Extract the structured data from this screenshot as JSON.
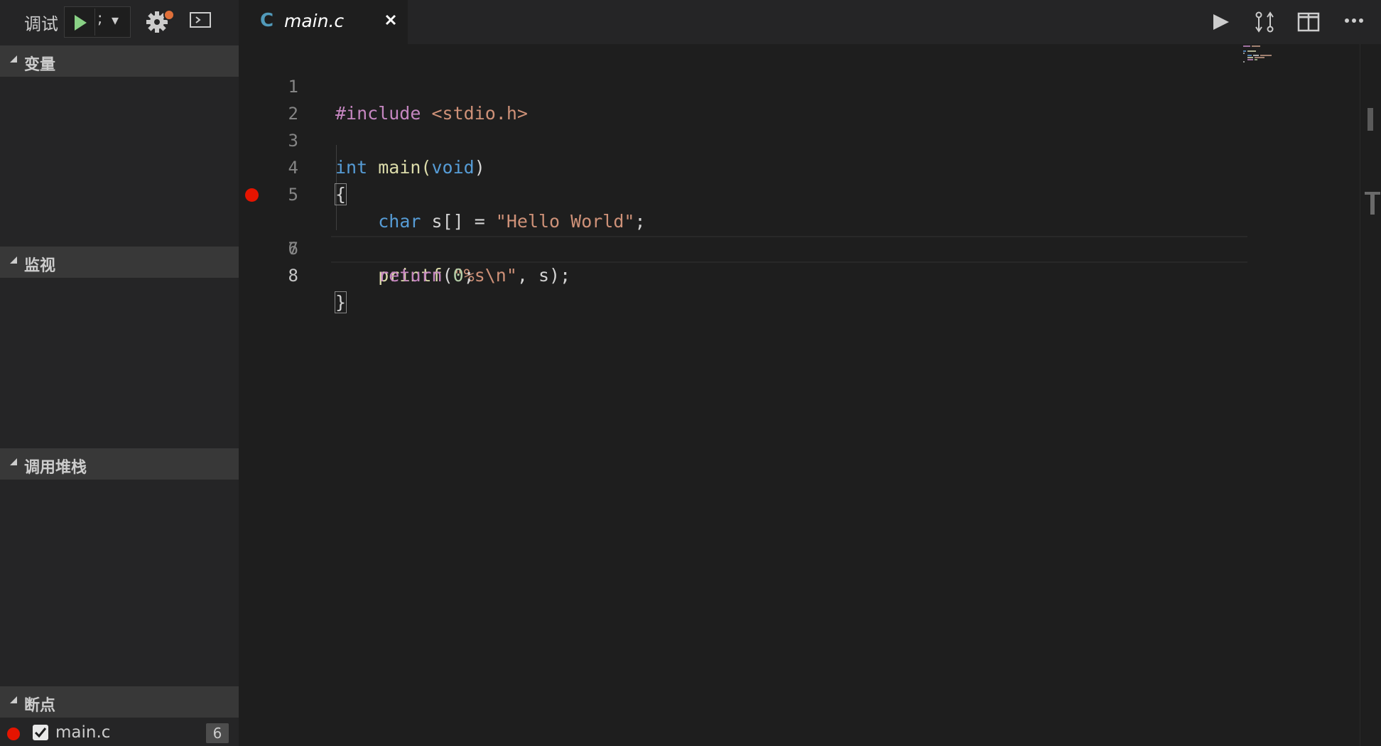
{
  "debug_toolbar": {
    "title": "调试",
    "config_name": ";",
    "config_caret": "▾"
  },
  "sections": {
    "variables": "变量",
    "watch": "监视",
    "call_stack": "调用堆栈",
    "breakpoints": "断点"
  },
  "breakpoint_item": {
    "file": "main.c",
    "line": "6"
  },
  "tab": {
    "lang_icon": "C",
    "name": "main.c",
    "close": "✕"
  },
  "code": {
    "line_numbers": [
      "1",
      "2",
      "3",
      "4",
      "5",
      "6",
      "7",
      "8"
    ],
    "l1": {
      "directive": "#include",
      "header": "<stdio.h>"
    },
    "l3": {
      "type": "int",
      "name": "main(",
      "param": "void",
      "close": ")"
    },
    "l4": {
      "brace": "{"
    },
    "l5": {
      "type": "char",
      "decl": " s[] = ",
      "str": "\"Hello World\"",
      "end": ";"
    },
    "l6": {
      "fn": "printf",
      "open": "(",
      "str": "\"%s\\n\"",
      "rest": ", s);"
    },
    "l7": {
      "kw": "return",
      "sp": " ",
      "num": "0",
      "end": ";"
    },
    "l8": {
      "brace": "}"
    }
  },
  "icons": {
    "continue": "play-icon",
    "gear": "gear-icon",
    "console": "debug-console-icon",
    "run": "run-icon",
    "compare": "open-changes-icon",
    "split": "split-editor-icon",
    "more": "more-actions-icon"
  },
  "colors": {
    "breakpoint": "#e51400",
    "play": "#89d185",
    "keyword": "#569cd6",
    "string": "#ce9178",
    "directive": "#c586c0",
    "function": "#dcdcaa",
    "number": "#b5cea8"
  }
}
